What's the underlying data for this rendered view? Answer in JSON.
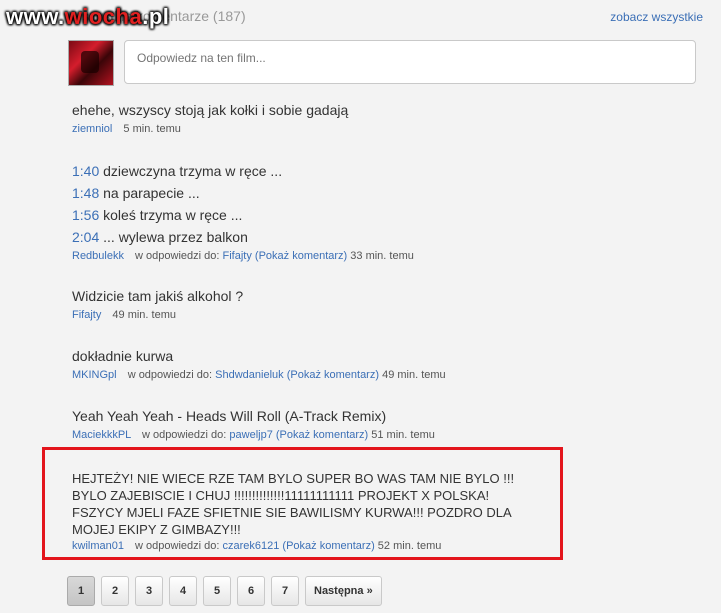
{
  "watermark": {
    "prefix": "www.",
    "brand": "wiocha",
    "suffix": ".pl"
  },
  "header": {
    "title": "Wszystkie komentarze (187)",
    "see_all": "zobacz wszystkie"
  },
  "reply": {
    "placeholder": "Odpowiedz na ten film..."
  },
  "labels": {
    "in_reply_to": "w odpowiedzi do:",
    "show_comment": "(Pokaż komentarz)"
  },
  "comments": [
    {
      "text": "ehehe, wszyscy stoją jak kołki i sobie gadają",
      "user": "ziemniol",
      "time": "5 min. temu"
    },
    {
      "lines": [
        {
          "ts": "1:40",
          "text": " dziewczyna trzyma w ręce ..."
        },
        {
          "ts": "1:48",
          "text": " na parapecie ..."
        },
        {
          "ts": "1:56",
          "text": " koleś trzyma w ręce ..."
        },
        {
          "ts": "2:04",
          "text": " ... wylewa przez balkon"
        }
      ],
      "user": "Redbulekk",
      "reply_to": "Fifajty",
      "time": "33 min. temu"
    },
    {
      "text": "Widzicie tam jakiś alkohol ?",
      "user": "Fifajty",
      "time": "49 min. temu"
    },
    {
      "text": "dokładnie kurwa",
      "user": "MKINGpl",
      "reply_to": "Shdwdanieluk",
      "time": "49 min. temu"
    },
    {
      "text": "Yeah Yeah Yeah - Heads Will Roll (A-Track Remix)",
      "user": "MaciekkkPL",
      "reply_to": "paweljp7",
      "time": "51 min. temu"
    },
    {
      "text": "HEJTEŻY! NIE WIECE RZE TAM BYLO SUPER BO WAS TAM NIE BYLO !!! BYLO ZAJEBISCIE I CHUJ !!!!!!!!!!!!!!11111111111 PROJEKT X POLSKA! FSZYCY MJELI FAZE SFIETNIE SIE BAWILISMY KURWA!!! POZDRO DLA MOJEJ EKIPY Z GIMBAZY!!!",
      "user": "kwilman01",
      "reply_to": "czarek6121",
      "time": "52 min. temu"
    }
  ],
  "pagination": {
    "pages": [
      "1",
      "2",
      "3",
      "4",
      "5",
      "6",
      "7"
    ],
    "next": "Następna »",
    "current": "1"
  },
  "colors": {
    "link": "#3b6fb6",
    "highlight": "#e3141b",
    "background": "#f3f3f3"
  }
}
